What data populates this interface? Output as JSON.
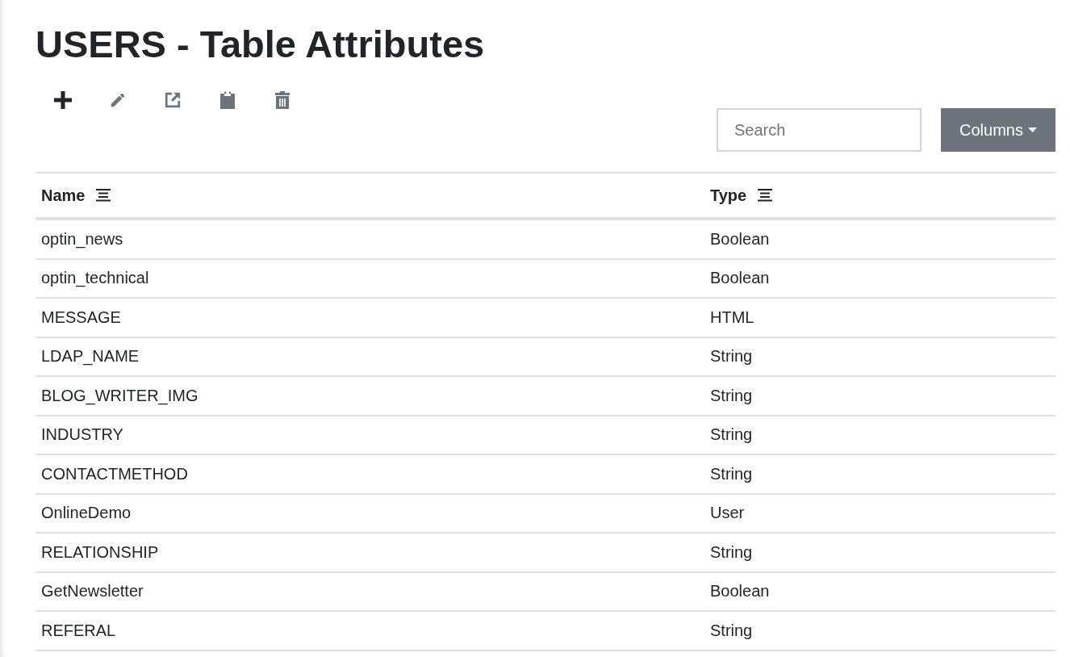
{
  "title": "USERS - Table Attributes",
  "toolbar": [
    {
      "kind": "add",
      "disabled": false
    },
    {
      "kind": "edit",
      "disabled": true
    },
    {
      "kind": "export",
      "disabled": true
    },
    {
      "kind": "paste",
      "disabled": true
    },
    {
      "kind": "delete",
      "disabled": true
    }
  ],
  "search": {
    "placeholder": "Search"
  },
  "columns_button": "Columns",
  "table": {
    "columns": [
      "Name",
      "Type"
    ],
    "rows": [
      [
        "optin_news",
        "Boolean"
      ],
      [
        "optin_technical",
        "Boolean"
      ],
      [
        "MESSAGE",
        "HTML"
      ],
      [
        "LDAP_NAME",
        "String"
      ],
      [
        "BLOG_WRITER_IMG",
        "String"
      ],
      [
        "INDUSTRY",
        "String"
      ],
      [
        "CONTACTMETHOD",
        "String"
      ],
      [
        "OnlineDemo",
        "User"
      ],
      [
        "RELATIONSHIP",
        "String"
      ],
      [
        "GetNewsletter",
        "Boolean"
      ],
      [
        "REFERAL",
        "String"
      ]
    ]
  }
}
